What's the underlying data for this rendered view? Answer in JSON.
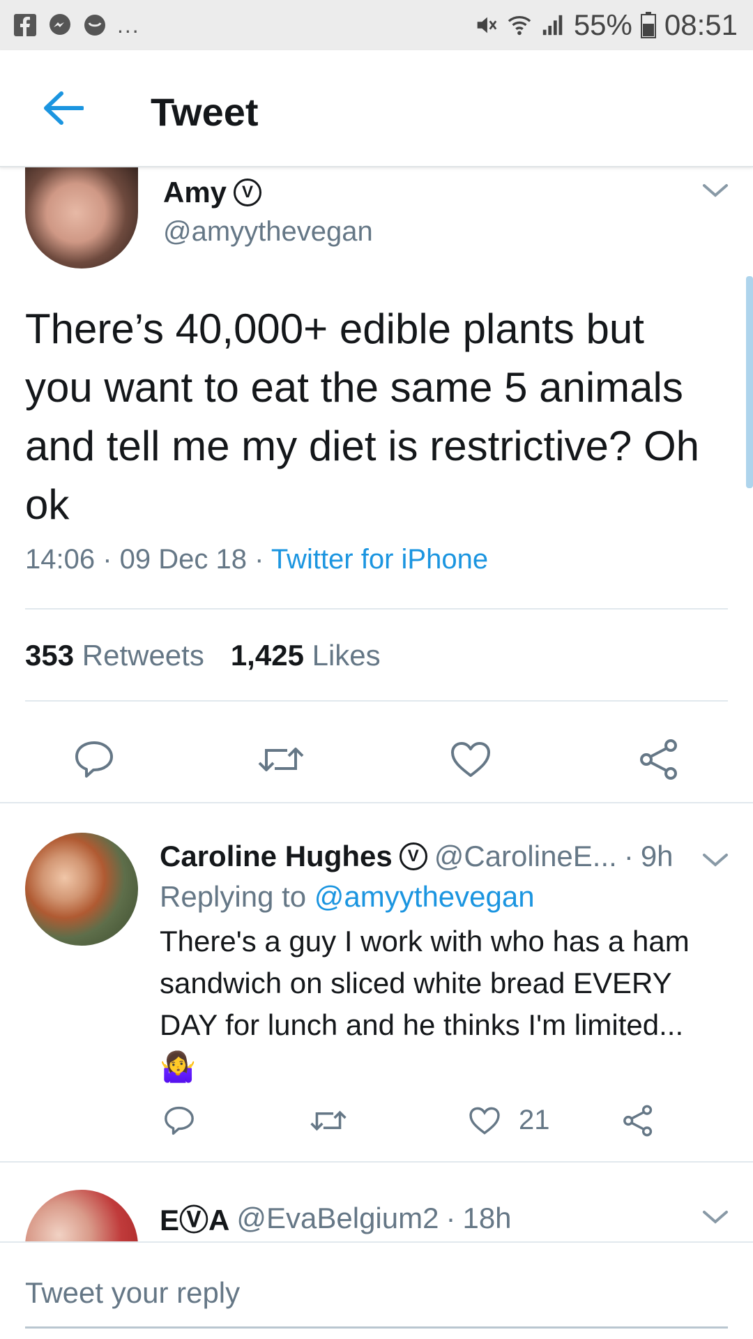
{
  "status_bar": {
    "left_icons": [
      "facebook-icon",
      "messenger-icon",
      "chat-icon"
    ],
    "more": "...",
    "right_icons": [
      "mute-icon",
      "wifi-icon",
      "signal-icon"
    ],
    "battery_percent": "55%",
    "time": "08:51"
  },
  "appbar": {
    "back_icon": "arrow-left-icon",
    "title": "Tweet"
  },
  "tweet": {
    "author_name": "Amy",
    "verified_mark": "V",
    "author_handle": "@amyythevegan",
    "text": "There’s 40,000+ edible plants but you want to eat the same 5 animals and tell me my diet is restrictive? Oh ok",
    "time": "14:06",
    "date": "09 Dec 18",
    "source": "Twitter for iPhone",
    "separator": " · ",
    "retweets_count": "353",
    "retweets_label": "Retweets",
    "likes_count": "1,425",
    "likes_label": "Likes",
    "action_icons": [
      "reply-icon",
      "retweet-icon",
      "heart-icon",
      "share-icon"
    ]
  },
  "replies": [
    {
      "name": "Caroline Hughes",
      "verified_mark": "V",
      "handle": "@CarolineE...",
      "age": "9h",
      "replying_prefix": "Replying to",
      "replying_to": "@amyythevegan",
      "text": "There's a guy I work with who has a ham sandwich on sliced white bread EVERY DAY for lunch and he thinks I'm limited...",
      "emoji": "🤷‍♀️",
      "likes": "21"
    },
    {
      "name": "EⓋA",
      "handle": "@EvaBelgium2",
      "age": "18h"
    }
  ],
  "composer": {
    "placeholder": "Tweet your reply"
  },
  "colors": {
    "accent": "#1b95e0",
    "muted": "#657786",
    "text": "#14171a",
    "divider": "#e1e8ed"
  }
}
